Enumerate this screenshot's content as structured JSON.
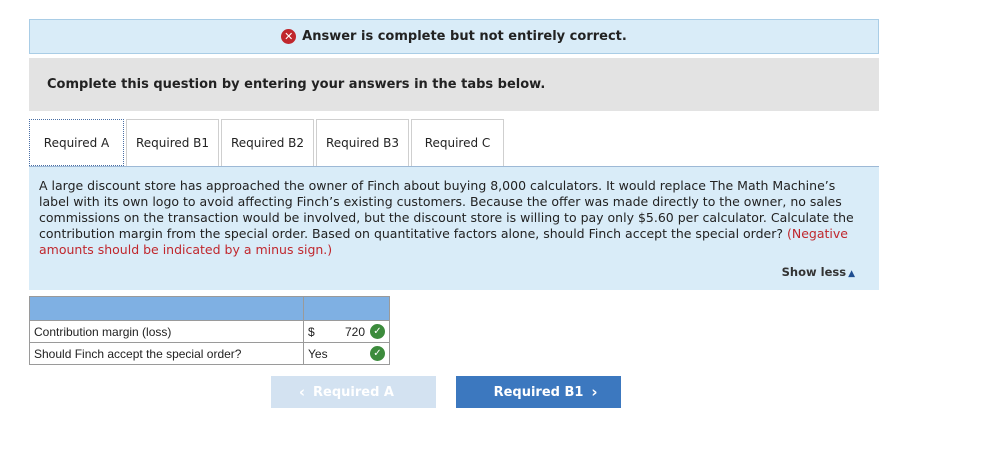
{
  "banner": {
    "icon": "x-circle-icon",
    "text": "Answer is complete but not entirely correct."
  },
  "instructions": "Complete this question by entering your answers in the tabs below.",
  "tabs": [
    {
      "label": "Required A",
      "active": true
    },
    {
      "label": "Required B1",
      "active": false
    },
    {
      "label": "Required B2",
      "active": false
    },
    {
      "label": "Required B3",
      "active": false
    },
    {
      "label": "Required C",
      "active": false
    }
  ],
  "question": {
    "text": "A large discount store has approached the owner of Finch about buying 8,000 calculators. It would replace The Math Machine’s label with its own logo to avoid affecting Finch’s existing customers. Because the offer was made directly to the owner, no sales commissions on the transaction would be involved, but the discount store is willing to pay only $5.60 per calculator. Calculate the contribution margin from the special order. Based on quantitative factors alone, should Finch accept the special order?",
    "note": "(Negative amounts should be indicated by a minus sign.)",
    "show_less": "Show less"
  },
  "answer_table": {
    "rows": [
      {
        "label": "Contribution margin (loss)",
        "currency": "$",
        "value": "720",
        "status": "correct"
      },
      {
        "label": "Should Finch accept the special order?",
        "currency": "",
        "value": "Yes",
        "status": "correct"
      }
    ]
  },
  "navigation": {
    "prev_label": "Required A",
    "next_label": "Required B1"
  },
  "colors": {
    "accent": "#3c78bf",
    "error": "#c0272d",
    "correct": "#3c8b3c",
    "panel": "#d9ecf8",
    "header": "#7fb0e3"
  }
}
